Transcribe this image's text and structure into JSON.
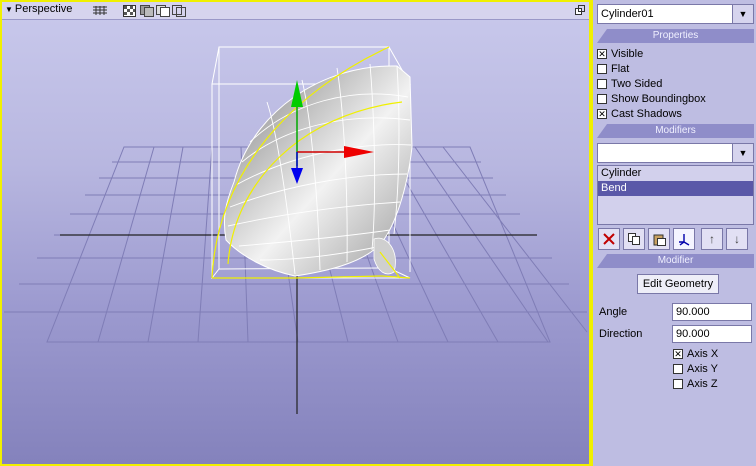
{
  "viewport": {
    "title": "Perspective"
  },
  "panel": {
    "object_select": {
      "value": "Cylinder01"
    },
    "properties_header": "Properties",
    "checkboxes": [
      {
        "label": "Visible",
        "checked": true
      },
      {
        "label": "Flat",
        "checked": false
      },
      {
        "label": "Two Sided",
        "checked": false
      },
      {
        "label": "Show Boundingbox",
        "checked": false
      },
      {
        "label": "Cast Shadows",
        "checked": true
      }
    ],
    "modifiers_header": "Modifiers",
    "modifier_select": {
      "value": ""
    },
    "modifier_list": [
      {
        "label": "Cylinder",
        "selected": false
      },
      {
        "label": "Bend",
        "selected": true
      }
    ],
    "modifier_header": "Modifier",
    "edit_geometry_label": "Edit Geometry",
    "angle_label": "Angle",
    "angle_value": "90.000",
    "direction_label": "Direction",
    "direction_value": "90.000",
    "axes": [
      {
        "label": "Axis X",
        "checked": true
      },
      {
        "label": "Axis Y",
        "checked": false
      },
      {
        "label": "Axis Z",
        "checked": false
      }
    ]
  },
  "colors": {
    "accent_border": "#f0f000",
    "section_header": "#8f8dc9",
    "selected_item": "#5a58a8"
  }
}
